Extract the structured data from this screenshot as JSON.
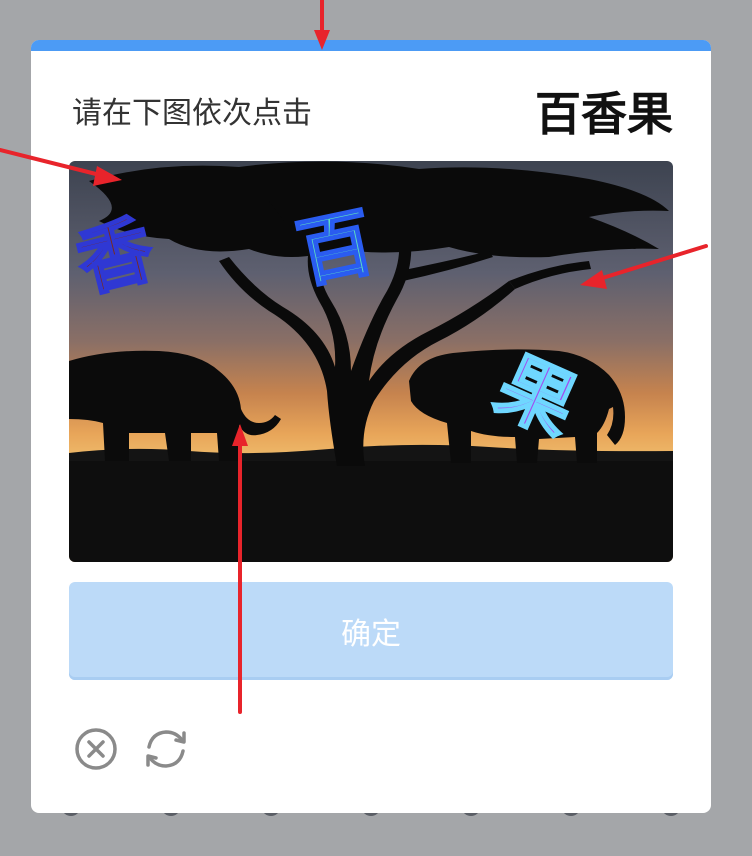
{
  "dialog": {
    "instruction": "请在下图依次点击",
    "target_chars": "百香果",
    "confirm_label": "确定"
  },
  "captcha": {
    "scene": "elephants under acacia tree at sunset",
    "chars": [
      {
        "char": "香",
        "color": "#7a2b1a",
        "outline": "#2f38d4"
      },
      {
        "char": "百",
        "color": "#5de0c0",
        "outline": "#2a5cf0"
      },
      {
        "char": "果",
        "color": "#a24cf0",
        "outline": "#6fd7ff"
      }
    ]
  },
  "icons": {
    "close": "close-circle-icon",
    "refresh": "refresh-icon"
  },
  "colors": {
    "accent": "#4c9bf5",
    "button_bg": "#bcdaf8",
    "backdrop": "#a4a6a9",
    "annotation_arrow": "#e8242b"
  }
}
